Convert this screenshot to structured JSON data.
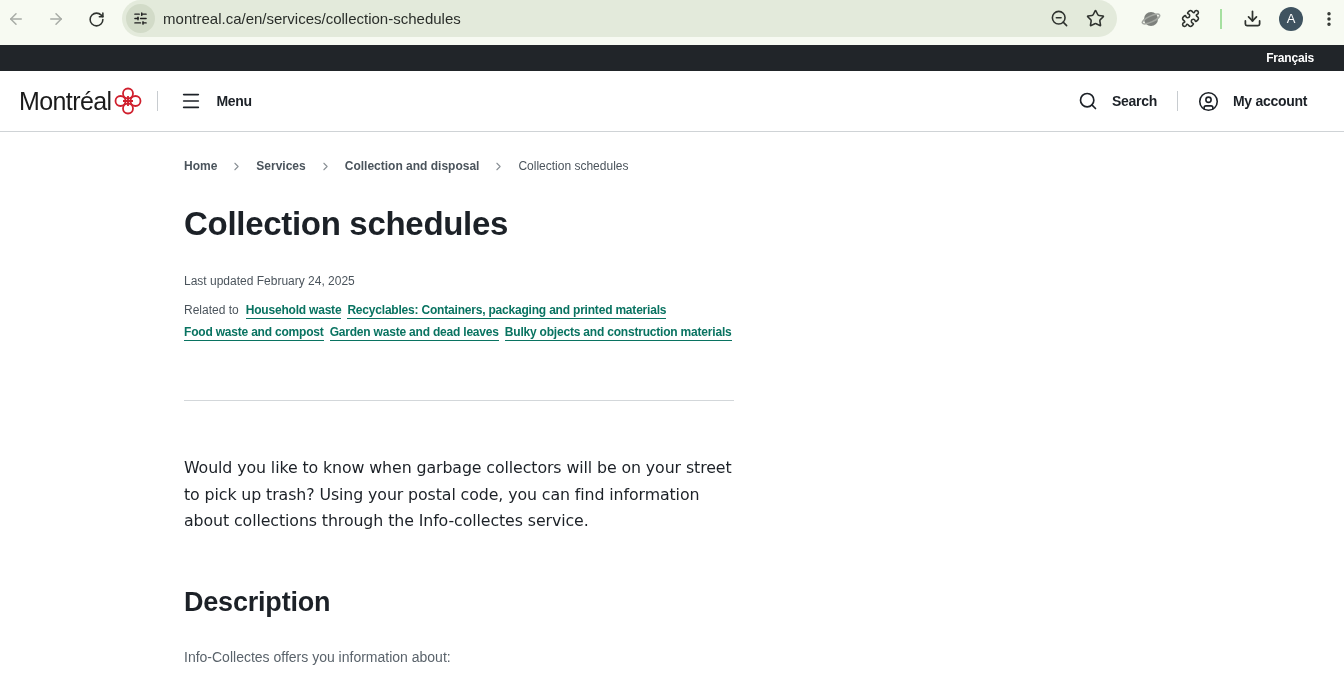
{
  "browser": {
    "nav_buttons": [
      {
        "kind": "back",
        "disabled": true
      },
      {
        "kind": "forward",
        "disabled": true
      },
      {
        "kind": "reload",
        "disabled": false
      }
    ],
    "url": "montreal.ca/en/services/collection-schedules",
    "profile_initial": "A"
  },
  "language_bar": {
    "link": "Français"
  },
  "header": {
    "logo": "Montréal",
    "menu": "Menu",
    "search": "Search",
    "account": "My account"
  },
  "breadcrumb": [
    {
      "label": "Home",
      "current": false
    },
    {
      "label": "Services",
      "current": false
    },
    {
      "label": "Collection and disposal",
      "current": false
    },
    {
      "label": "Collection schedules",
      "current": true
    }
  ],
  "title": "Collection schedules",
  "last_updated": "Last updated February 24, 2025",
  "related": {
    "label": "Related to",
    "links": [
      "Household waste",
      "Recyclables: Containers, packaging and printed materials",
      "Food waste and compost",
      "Garden waste and dead leaves",
      "Bulky objects and construction materials"
    ]
  },
  "intro": "Would you like to know when garbage collectors will be on your street to pick up trash? Using your postal code, you can find information about collections through the Info-collectes service.",
  "sections": [
    {
      "heading": "Description",
      "text": "Info-Collectes offers you information about:"
    }
  ]
}
